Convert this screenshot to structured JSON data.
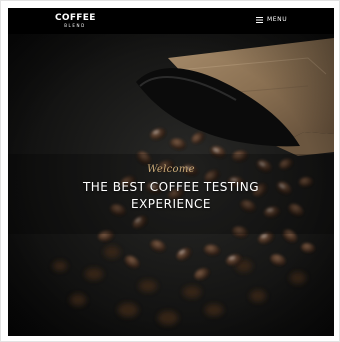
{
  "header": {
    "logo_main": "COFFEE",
    "logo_sub": "BLEND",
    "menu_label": "MENU",
    "menu_icon": "hamburger-menu-icon"
  },
  "hero": {
    "subheading": "Welcome",
    "headline_line1": "THE BEST COFFEE TESTING",
    "headline_line2": "EXPERIENCE",
    "background": "coffee-beans-spilling-from-paper-bag-photo"
  },
  "colors": {
    "header_bg": "#000000",
    "accent_gold": "#c9a977",
    "text_white": "#ffffff"
  }
}
